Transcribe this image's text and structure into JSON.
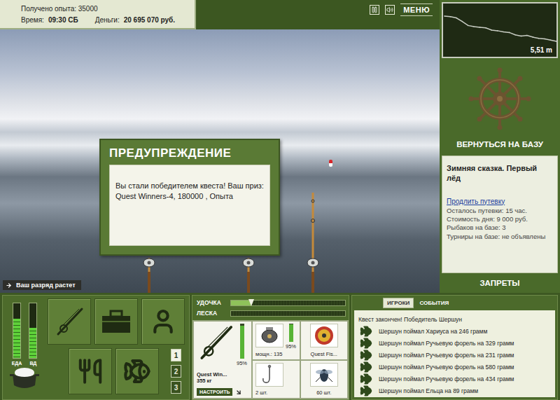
{
  "hud": {
    "experience": "Получено опыта: 35000",
    "time_label": "Время:",
    "time": "09:30 СБ",
    "money_label": "Деньги:",
    "money": "20 695 070 руб."
  },
  "menu": {
    "label": "МЕНЮ"
  },
  "depth_chart": {
    "reading": "5,51 m",
    "profile": [
      1.2,
      1.3,
      1.5,
      2.1,
      2.8,
      3.0,
      3.1,
      3.2,
      3.6,
      3.7,
      3.9,
      4.0,
      4.4,
      4.6,
      4.5,
      4.8,
      5.0,
      5.1,
      5.3,
      5.51
    ]
  },
  "dialog": {
    "title": "ПРЕДУПРЕЖДЕНИЕ",
    "message": "Вы стали победителем квеста! Ваш приз: Quest Winners-4, 180000 , Опыта"
  },
  "notice": {
    "text": "Ваш разряд растет"
  },
  "base_panel": {
    "return_label": "ВЕРНУТЬСЯ НА БАЗУ",
    "title": "Зимняя сказка. Первый лёд",
    "extend_link": "Продлить путевку",
    "details": [
      "Осталось путевки: 15 час.",
      "Стоимость дня: 9 000 руб.",
      "Рыбаков на базе: 3",
      "Турниры на базе: не объявлены"
    ],
    "bans_label": "ЗАПРЕТЫ"
  },
  "needs": [
    {
      "label": "ЕДА",
      "level": 0.72
    },
    {
      "label": "ВД",
      "level": 0.55
    }
  ],
  "rod_slots": [
    {
      "label": "1",
      "selected": true
    },
    {
      "label": "2",
      "selected": false
    },
    {
      "label": "3",
      "selected": false
    }
  ],
  "tension": [
    {
      "label": "УДОЧКА",
      "level": 0.18
    },
    {
      "label": "ЛЕСКА",
      "level": 0.0
    }
  ],
  "tackle": {
    "rod": {
      "name": "Quest Win...",
      "weight": "355 кг",
      "level": 0.95,
      "wear": "95%",
      "button": "НАСТРОИТЬ"
    },
    "reel": {
      "power": "мощн.: 135",
      "level": 0.95,
      "wear": "95%"
    },
    "line": {
      "name": "Quest Fis..."
    },
    "hook": {
      "count": "2 шт."
    },
    "bait": {
      "count": "60 шт."
    }
  },
  "feed": {
    "tabs": [
      {
        "label": "ИГРОКИ",
        "selected": true
      },
      {
        "label": "СОБЫТИЯ",
        "selected": false
      }
    ],
    "items": [
      {
        "kind": "notice",
        "text": "Квест закончен! Победитель Шершун"
      },
      {
        "kind": "catch",
        "text": "Шершун поймал Хариуса на 246 грамм"
      },
      {
        "kind": "catch",
        "text": "Шершун поймал Ручьевую форель на 329 грамм"
      },
      {
        "kind": "catch",
        "text": "Шершун поймал Ручьевую форель на 231 грамм"
      },
      {
        "kind": "catch",
        "text": "Шершун поймал Ручьевую форель на 580 грамм"
      },
      {
        "kind": "catch",
        "text": "Шершун поймал Ручьевую форель на 434 грамм"
      },
      {
        "kind": "catch",
        "text": "Шершун поймал Ельца на 89 грамм"
      }
    ]
  }
}
